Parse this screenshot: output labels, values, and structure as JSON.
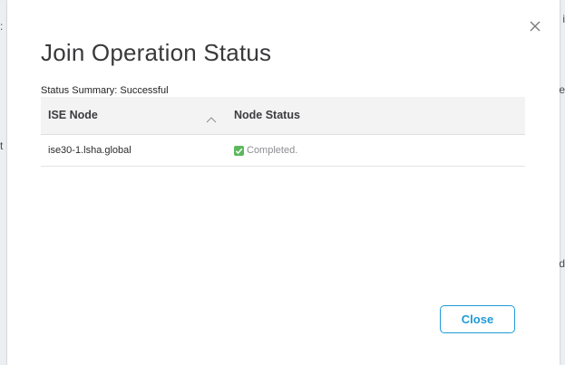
{
  "dialog": {
    "title": "Join Operation Status",
    "summary_label": "Status Summary:",
    "summary_value": "Successful",
    "close_icon": "close-icon",
    "close_button_label": "Close"
  },
  "table": {
    "columns": [
      {
        "label": "ISE Node",
        "sort_icon": "chevron-up-icon"
      },
      {
        "label": "Node Status"
      }
    ],
    "rows": [
      {
        "node": "ise30-1.lsha.global",
        "status": "Completed.",
        "status_icon": "check-icon"
      }
    ]
  },
  "background": {
    "left_fragments": [
      ":",
      "t"
    ],
    "right_fragments": [
      "i",
      "e",
      "d"
    ]
  },
  "colors": {
    "accent": "#1e9bd7",
    "success": "#5cb85c",
    "header_bg": "#f3f3f4"
  }
}
